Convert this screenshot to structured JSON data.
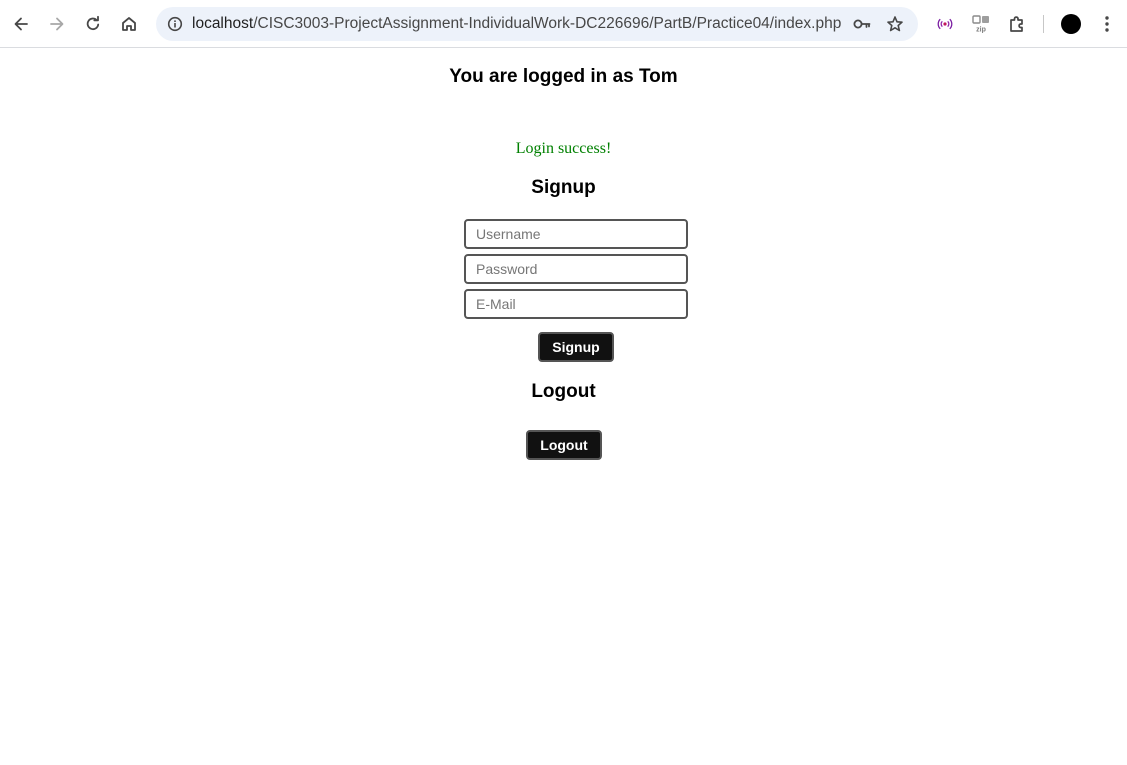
{
  "browser": {
    "url_host": "localhost",
    "url_path": "/CISC3003-ProjectAssignment-IndividualWork-DC226696/PartB/Practice04/index.php?l...",
    "icons": {
      "back": "arrow-left-icon",
      "forward": "arrow-right-icon",
      "reload": "reload-icon",
      "home": "home-icon",
      "site_info": "info-icon",
      "password": "key-icon",
      "bookmark": "star-icon",
      "cast": "broadcast-icon",
      "zip_ext": "zip-extension-icon",
      "extensions": "puzzle-icon",
      "profile": "avatar",
      "menu": "kebab-menu-icon"
    }
  },
  "page": {
    "logged_in_text": "You are logged in as Tom",
    "status_message": "Login success!",
    "signup": {
      "heading": "Signup",
      "username_placeholder": "Username",
      "password_placeholder": "Password",
      "email_placeholder": "E-Mail",
      "button_label": "Signup"
    },
    "logout": {
      "heading": "Logout",
      "button_label": "Logout"
    }
  },
  "colors": {
    "status_success": "#008000",
    "button_bg": "#111111",
    "omnibox_bg": "#edf2fa"
  }
}
